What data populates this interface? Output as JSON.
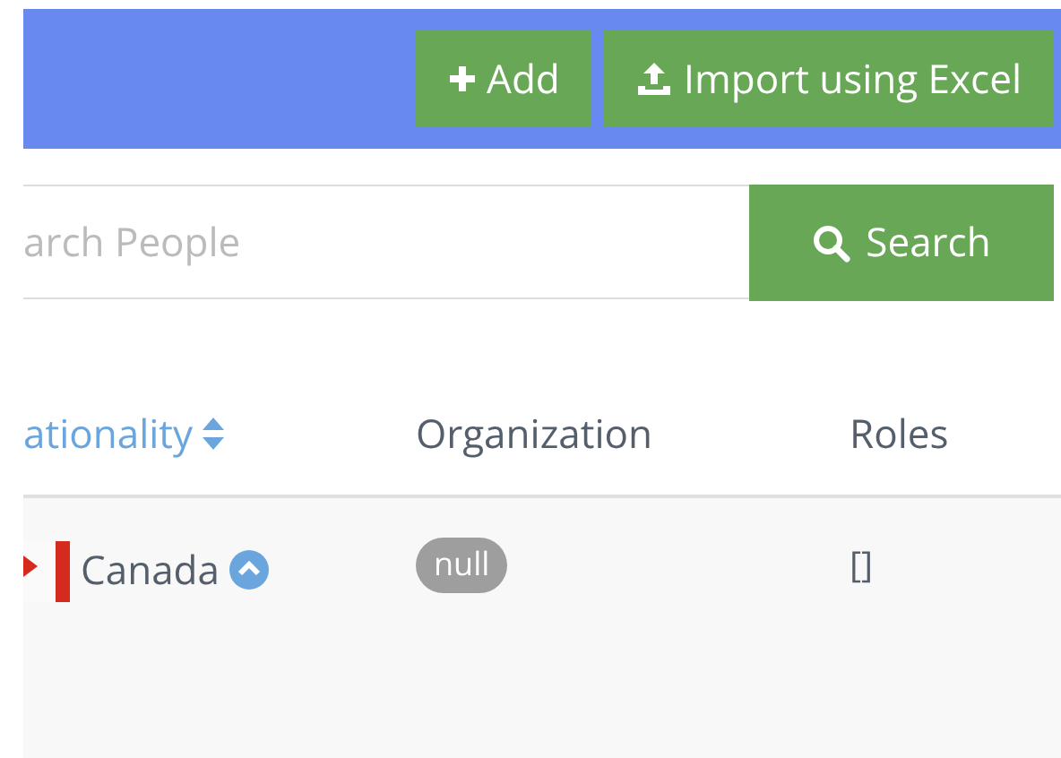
{
  "toolbar": {
    "buttons": [
      {
        "kind": "add",
        "label": "Add"
      },
      {
        "kind": "import",
        "label": "Import using Excel"
      }
    ]
  },
  "search": {
    "placeholder": "arch People",
    "button": "Search"
  },
  "table": {
    "columns": [
      {
        "label": "ationality",
        "sortable": true
      },
      {
        "label": "Organization",
        "sortable": false
      },
      {
        "label": "Roles",
        "sortable": false
      }
    ],
    "rows": [
      {
        "nationality": "Canada",
        "organization": "null",
        "roles": "[]"
      }
    ]
  }
}
